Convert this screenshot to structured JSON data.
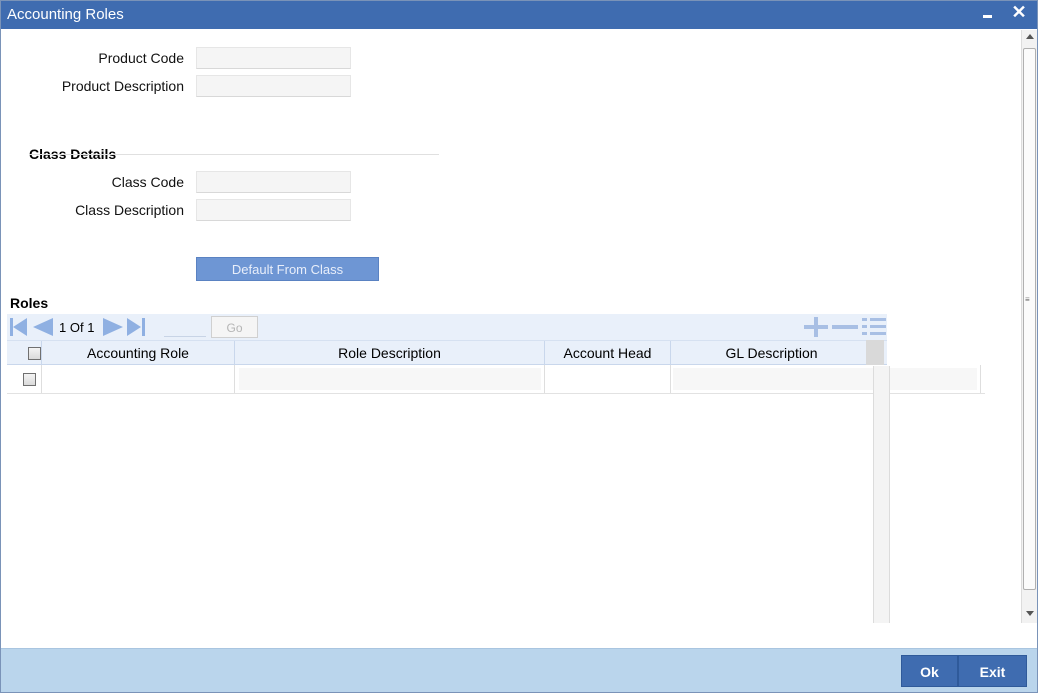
{
  "window": {
    "title": "Accounting Roles"
  },
  "product": {
    "code_label": "Product Code",
    "code_value": "",
    "description_label": "Product Description",
    "description_value": ""
  },
  "class_details": {
    "section_title": "Class Details",
    "code_label": "Class Code",
    "code_value": "",
    "description_label": "Class Description",
    "description_value": ""
  },
  "default_button_label": "Default From Class",
  "roles": {
    "section_title": "Roles",
    "pager": {
      "current": "1",
      "of_label": "Of",
      "total": "1",
      "page_input_value": "",
      "go_label": "Go"
    },
    "columns": [
      "Accounting Role",
      "Role Description",
      "Account Head",
      "GL Description"
    ],
    "rows": [
      {
        "accounting_role": "",
        "role_description": "",
        "account_head": "",
        "gl_description": ""
      }
    ]
  },
  "footer": {
    "ok_label": "Ok",
    "exit_label": "Exit"
  },
  "colors": {
    "titlebar": "#3f6cb0",
    "footer": "#bad5ec",
    "toolbar": "#e9f0fa",
    "icon": "#8fb0e2"
  },
  "icons": {
    "minimize": "minimize-icon",
    "close": "close-icon",
    "first": "first-page-icon",
    "prev": "prev-page-icon",
    "next": "next-page-icon",
    "last": "last-page-icon",
    "add": "add-row-icon",
    "delete": "delete-row-icon",
    "view": "single-view-icon"
  }
}
